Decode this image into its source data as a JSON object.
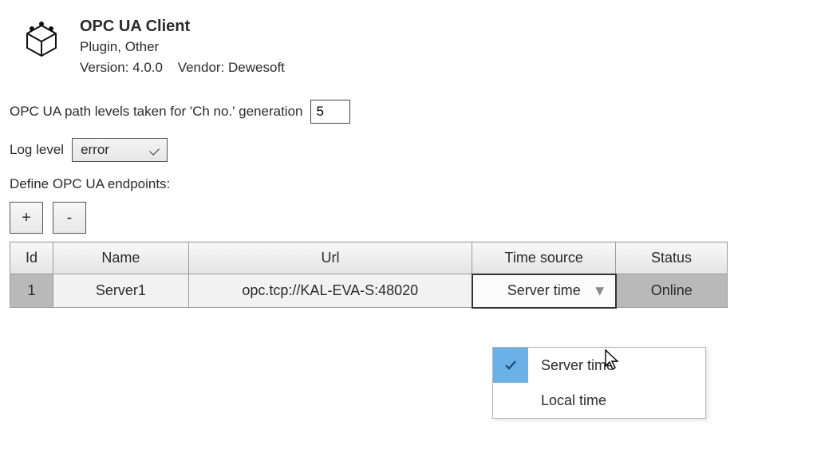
{
  "header": {
    "title": "OPC UA Client",
    "subtitle": "Plugin, Other",
    "version_label": "Version: 4.0.0",
    "vendor_label": "Vendor: Dewesoft"
  },
  "path_levels": {
    "label": "OPC UA path levels taken for 'Ch no.' generation",
    "value": "5"
  },
  "log_level": {
    "label": "Log level",
    "value": "error"
  },
  "endpoints_label": "Define OPC UA endpoints:",
  "buttons": {
    "add": "+",
    "remove": "-"
  },
  "table": {
    "headers": {
      "id": "Id",
      "name": "Name",
      "url": "Url",
      "time": "Time source",
      "status": "Status"
    },
    "rows": [
      {
        "id": "1",
        "name": "Server1",
        "url": "opc.tcp://KAL-EVA-S:48020",
        "time": "Server time",
        "status": "Online"
      }
    ]
  },
  "dropdown": {
    "options": [
      {
        "label": "Server time",
        "selected": true
      },
      {
        "label": "Local time",
        "selected": false
      }
    ]
  }
}
